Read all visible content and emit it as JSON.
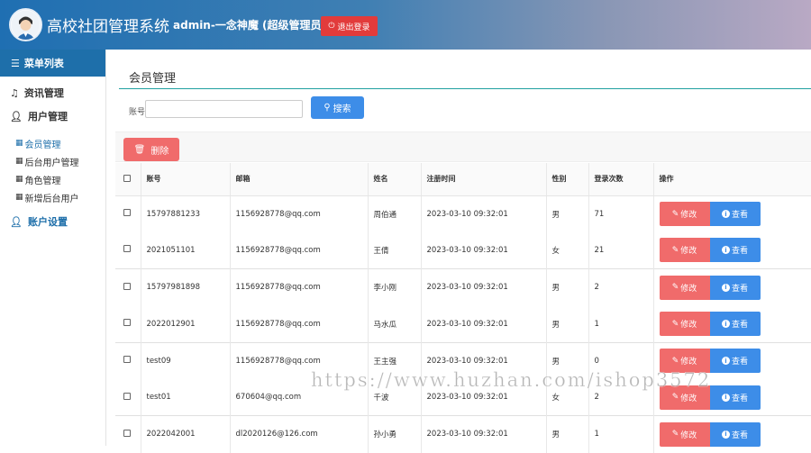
{
  "header": {
    "app_title": "高校社团管理系统",
    "user_info": "admin-一念神魔 (超级管理员)",
    "logout_label": "退出登录"
  },
  "sidebar": {
    "heading": "菜单列表",
    "groups": [
      {
        "label": "资讯管理",
        "icon": "music-note-icon"
      },
      {
        "label": "用户管理",
        "icon": "user-icon"
      },
      {
        "label": "账户设置",
        "icon": "user-icon"
      }
    ],
    "subitems": [
      {
        "label": "会员管理",
        "active": true
      },
      {
        "label": "后台用户管理",
        "active": false
      },
      {
        "label": "角色管理",
        "active": false
      },
      {
        "label": "新增后台用户",
        "active": false
      }
    ]
  },
  "main": {
    "page_title": "会员管理",
    "search_label": "账号:",
    "search_value": "",
    "search_button": "搜索",
    "delete_button": "删除",
    "columns": [
      "账号",
      "邮箱",
      "姓名",
      "注册时间",
      "性别",
      "登录次数",
      "操作"
    ],
    "edit_label": "修改",
    "view_label": "查看",
    "rows": [
      {
        "account": "15797881233",
        "email": "1156928778@qq.com",
        "name": "周伯通",
        "time": "2023-03-10 09:32:01",
        "gender": "男",
        "logins": "71"
      },
      {
        "account": "2021051101",
        "email": "1156928778@qq.com",
        "name": "王倩",
        "time": "2023-03-10 09:32:01",
        "gender": "女",
        "logins": "21"
      },
      {
        "account": "15797981898",
        "email": "1156928778@qq.com",
        "name": "李小刚",
        "time": "2023-03-10 09:32:01",
        "gender": "男",
        "logins": "2"
      },
      {
        "account": "2022012901",
        "email": "1156928778@qq.com",
        "name": "马水瓜",
        "time": "2023-03-10 09:32:01",
        "gender": "男",
        "logins": "1"
      },
      {
        "account": "test09",
        "email": "1156928778@qq.com",
        "name": "王主强",
        "time": "2023-03-10 09:32:01",
        "gender": "男",
        "logins": "0"
      },
      {
        "account": "test01",
        "email": "670604@qq.com",
        "name": "千波",
        "time": "2023-03-10 09:32:01",
        "gender": "女",
        "logins": "2"
      },
      {
        "account": "2022042001",
        "email": "dl2020126@126.com",
        "name": "孙小勇",
        "time": "2023-03-10 09:32:01",
        "gender": "男",
        "logins": "1"
      }
    ]
  },
  "watermark": "https://www.huzhan.com/ishop3572",
  "colors": {
    "header_blue": "#1e6faa",
    "danger": "#f06b6b",
    "primary": "#3d8de8",
    "accent_line": "#21a0a0"
  }
}
